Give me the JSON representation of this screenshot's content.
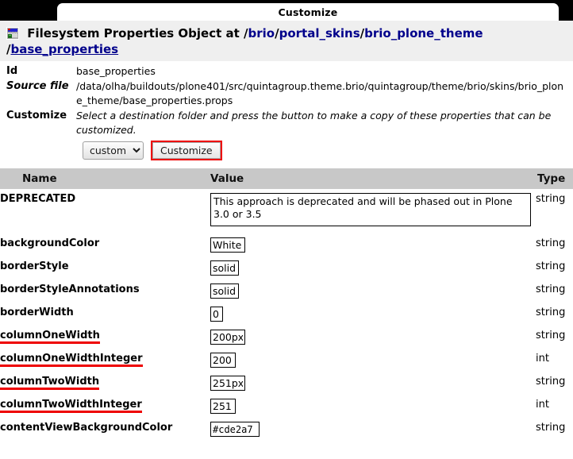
{
  "window": {
    "tab_label": "Customize"
  },
  "object_header": {
    "icon": "properties-object-icon",
    "prefix": "Filesystem Properties Object at",
    "path_segments": [
      {
        "text": "brio",
        "link": false
      },
      {
        "text": "portal_skins",
        "link": false
      },
      {
        "text": "brio_plone_theme",
        "link": false
      },
      {
        "text": "base_properties",
        "link": true
      }
    ]
  },
  "details": {
    "id_label": "Id",
    "id_value": "base_properties",
    "source_label": "Source file",
    "source_value": "/data/olha/buildouts/plone401/src/quintagroup.theme.brio/quintagroup/theme/brio/skins/brio_plone_theme/base_properties.props",
    "customize_label": "Customize",
    "customize_help": "Select a destination folder and press the button to make a copy of these properties that can be customized.",
    "folder_selected": "custom",
    "folder_options": [
      "custom"
    ],
    "customize_button": "Customize"
  },
  "table": {
    "headers": {
      "name": "Name",
      "value": "Value",
      "type": "Type"
    },
    "rows": [
      {
        "name": "DEPRECATED",
        "highlighted": false,
        "control": "textarea",
        "value": "This approach is deprecated and will be phased out in Plone 3.0 or 3.5",
        "type": "string",
        "size": 0
      },
      {
        "name": "backgroundColor",
        "highlighted": false,
        "control": "input",
        "value": "White",
        "type": "string",
        "size": 38
      },
      {
        "name": "borderStyle",
        "highlighted": false,
        "control": "input",
        "value": "solid",
        "type": "string",
        "size": 30
      },
      {
        "name": "borderStyleAnnotations",
        "highlighted": false,
        "control": "input",
        "value": "solid",
        "type": "string",
        "size": 30
      },
      {
        "name": "borderWidth",
        "highlighted": false,
        "control": "input",
        "value": "0",
        "type": "string",
        "size": 10
      },
      {
        "name": "columnOneWidth",
        "highlighted": true,
        "control": "input",
        "value": "200px",
        "type": "string",
        "size": 38
      },
      {
        "name": "columnOneWidthInteger",
        "highlighted": true,
        "control": "input",
        "value": "200",
        "type": "int",
        "size": 26
      },
      {
        "name": "columnTwoWidth",
        "highlighted": true,
        "control": "input",
        "value": "251px",
        "type": "string",
        "size": 38
      },
      {
        "name": "columnTwoWidthInteger",
        "highlighted": true,
        "control": "input",
        "value": "251",
        "type": "int",
        "size": 26
      },
      {
        "name": "contentViewBackgroundColor",
        "highlighted": false,
        "control": "input-mono",
        "value": "#cde2a7",
        "type": "string",
        "size": 56
      }
    ]
  },
  "colors": {
    "tabstrip_bg": "#000000",
    "tab_bg": "#ffffff",
    "header_band_bg": "#efefef",
    "table_header_bg": "#c8c8c8",
    "link_blue": "#00008b",
    "highlight_red": "#ee0000"
  }
}
